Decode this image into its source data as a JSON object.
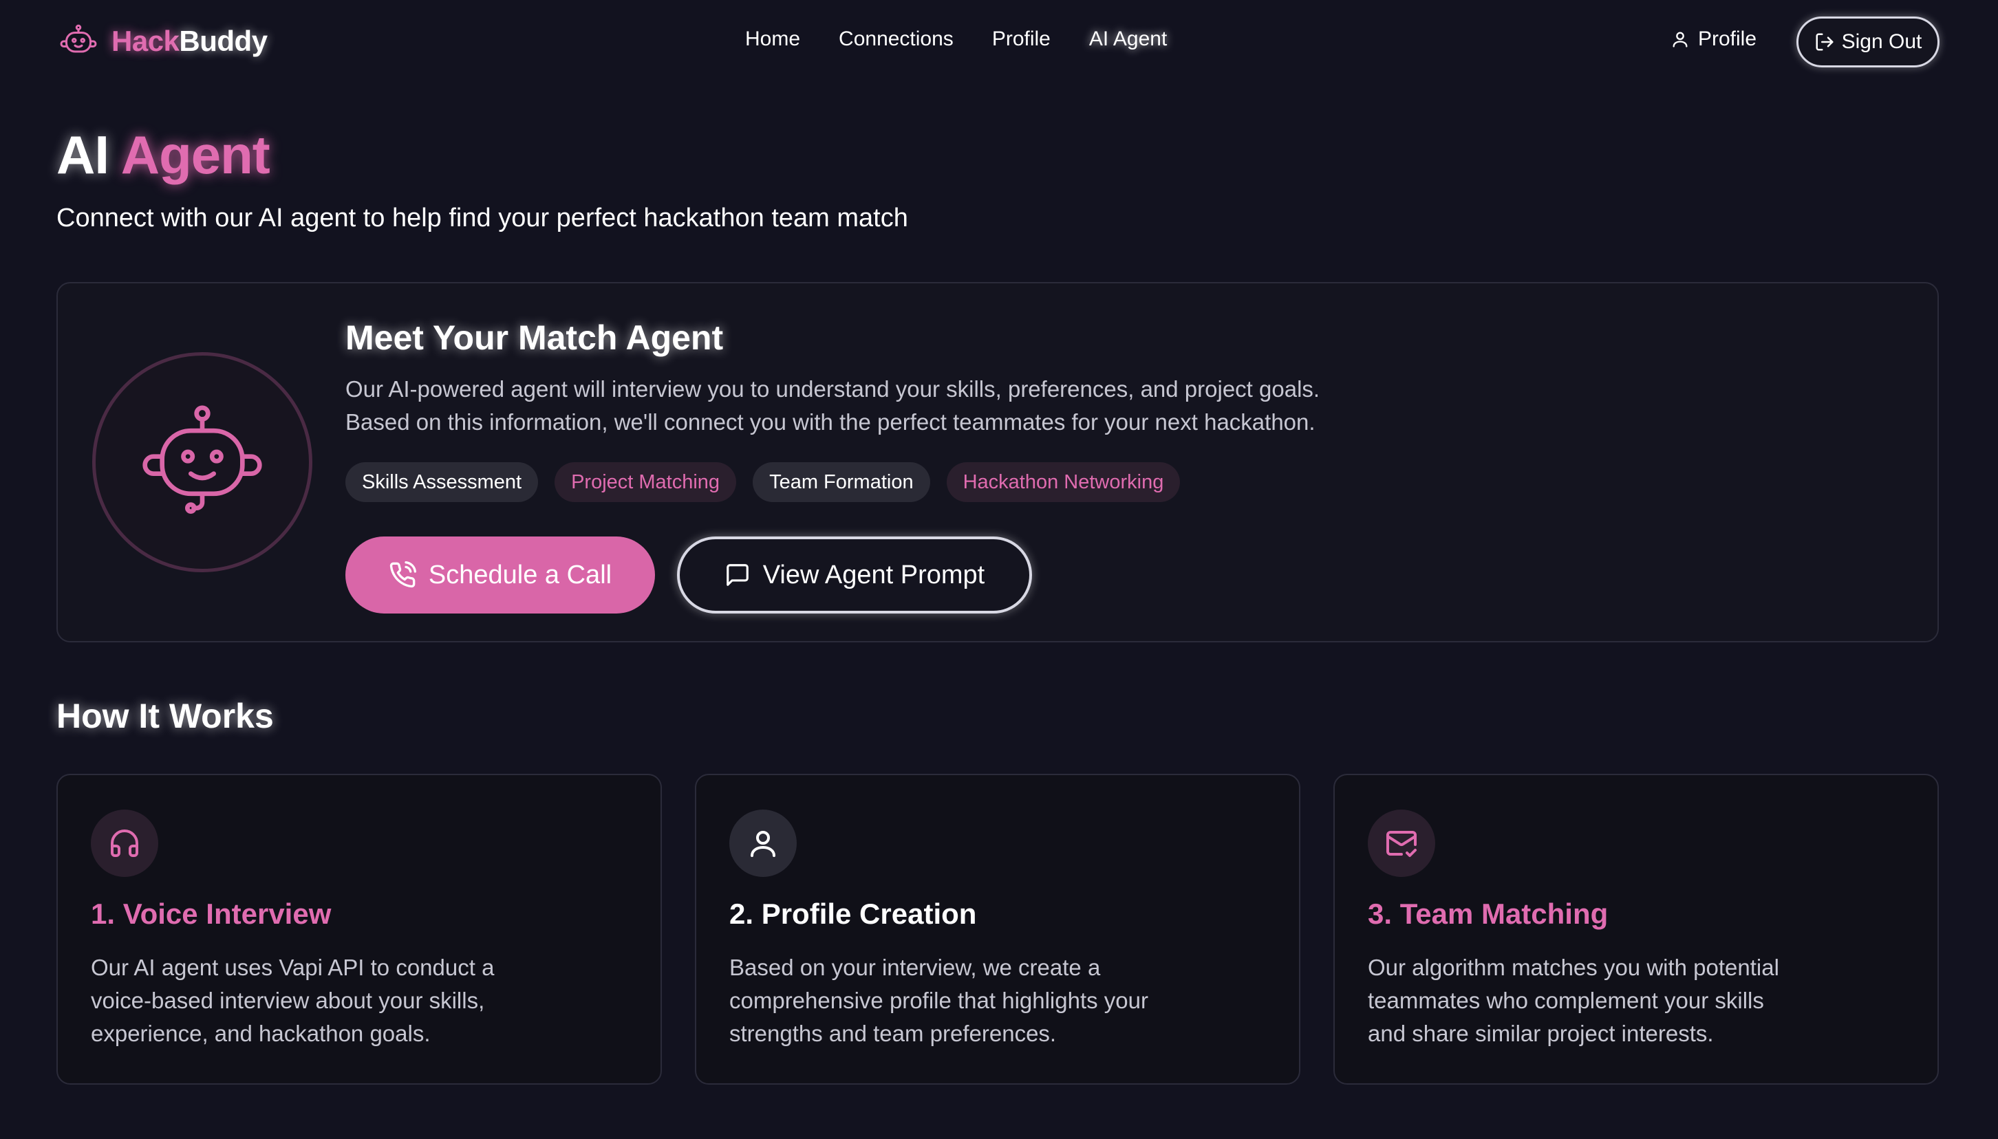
{
  "brand": {
    "part1": "Hack",
    "part2": "Buddy"
  },
  "nav": {
    "items": [
      "Home",
      "Connections",
      "Profile",
      "AI Agent"
    ],
    "active": "AI Agent"
  },
  "header": {
    "profile_label": "Profile",
    "signout_label": "Sign Out"
  },
  "page": {
    "title_part1": "AI",
    "title_part2": "Agent",
    "subtitle": "Connect with our AI agent to help find your perfect hackathon team match"
  },
  "hero": {
    "title": "Meet Your Match Agent",
    "description_line1": "Our AI-powered agent will interview you to understand your skills, preferences, and project goals.",
    "description_line2": "Based on this information, we'll connect you with the perfect teammates for your next hackathon.",
    "tags": [
      "Skills Assessment",
      "Project Matching",
      "Team Formation",
      "Hackathon Networking"
    ],
    "primary_button": "Schedule a Call",
    "secondary_button": "View Agent Prompt"
  },
  "how": {
    "title": "How It Works",
    "steps": [
      {
        "title": "1. Voice Interview",
        "icon": "headphones-icon",
        "description": "Our AI agent uses Vapi API to conduct a voice-based interview about your skills, experience, and hackathon goals."
      },
      {
        "title": "2. Profile Creation",
        "icon": "user-icon",
        "description": "Based on your interview, we create a comprehensive profile that highlights your strengths and team preferences."
      },
      {
        "title": "3. Team Matching",
        "icon": "mail-check-icon",
        "description": "Our algorithm matches you with potential teammates who complement your skills and share similar project interests."
      }
    ]
  },
  "colors": {
    "accent": "#e06cb0",
    "background": "#12121f",
    "card": "#14141f",
    "primary_button": "#d966a8"
  }
}
